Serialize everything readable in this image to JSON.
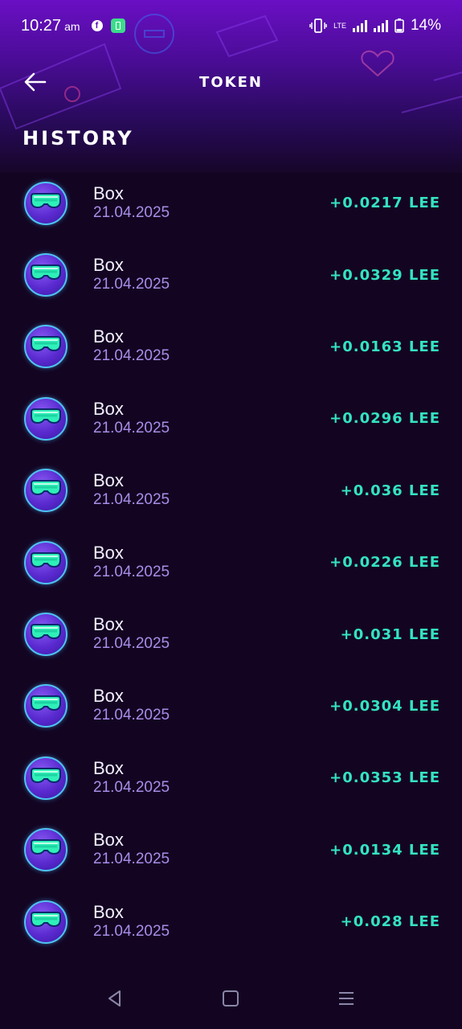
{
  "status_bar": {
    "time": "10:27",
    "ampm": "am",
    "battery": "14%",
    "network": "LTE"
  },
  "header": {
    "title": "TOKEN"
  },
  "section": {
    "title": "HISTORY"
  },
  "colors": {
    "accent": "#34e3c3",
    "header_purple": "#6a0fc4",
    "background": "#130522",
    "date_color": "#a98de8"
  },
  "history": [
    {
      "name": "Box",
      "date": "21.04.2025",
      "amount": "+0.0217 LEE",
      "icon": "goggles-icon"
    },
    {
      "name": "Box",
      "date": "21.04.2025",
      "amount": "+0.0329 LEE",
      "icon": "goggles-icon"
    },
    {
      "name": "Box",
      "date": "21.04.2025",
      "amount": "+0.0163 LEE",
      "icon": "goggles-icon"
    },
    {
      "name": "Box",
      "date": "21.04.2025",
      "amount": "+0.0296 LEE",
      "icon": "goggles-icon"
    },
    {
      "name": "Box",
      "date": "21.04.2025",
      "amount": "+0.036 LEE",
      "icon": "goggles-icon"
    },
    {
      "name": "Box",
      "date": "21.04.2025",
      "amount": "+0.0226 LEE",
      "icon": "goggles-icon"
    },
    {
      "name": "Box",
      "date": "21.04.2025",
      "amount": "+0.031 LEE",
      "icon": "goggles-icon"
    },
    {
      "name": "Box",
      "date": "21.04.2025",
      "amount": "+0.0304 LEE",
      "icon": "goggles-icon"
    },
    {
      "name": "Box",
      "date": "21.04.2025",
      "amount": "+0.0353 LEE",
      "icon": "goggles-icon"
    },
    {
      "name": "Box",
      "date": "21.04.2025",
      "amount": "+0.0134 LEE",
      "icon": "goggles-icon"
    },
    {
      "name": "Box",
      "date": "21.04.2025",
      "amount": "+0.028 LEE",
      "icon": "goggles-icon"
    }
  ]
}
